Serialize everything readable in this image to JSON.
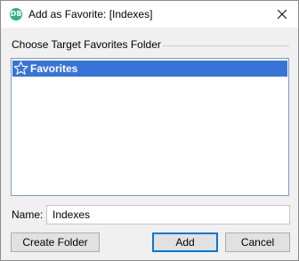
{
  "window": {
    "title": "Add as Favorite: [Indexes]",
    "app_icon": "app-logo-icon",
    "close_icon": "close-icon"
  },
  "group": {
    "label": "Choose Target Favorites Folder"
  },
  "tree": {
    "items": [
      {
        "label": "Favorites",
        "icon": "star-icon",
        "selected": true
      }
    ]
  },
  "name_field": {
    "label": "Name:",
    "value": "Indexes"
  },
  "buttons": {
    "create_folder": "Create Folder",
    "add": "Add",
    "cancel": "Cancel"
  },
  "colors": {
    "selection": "#3874d8",
    "app_icon": "#2bb673",
    "default_button_border": "#0078d7"
  }
}
